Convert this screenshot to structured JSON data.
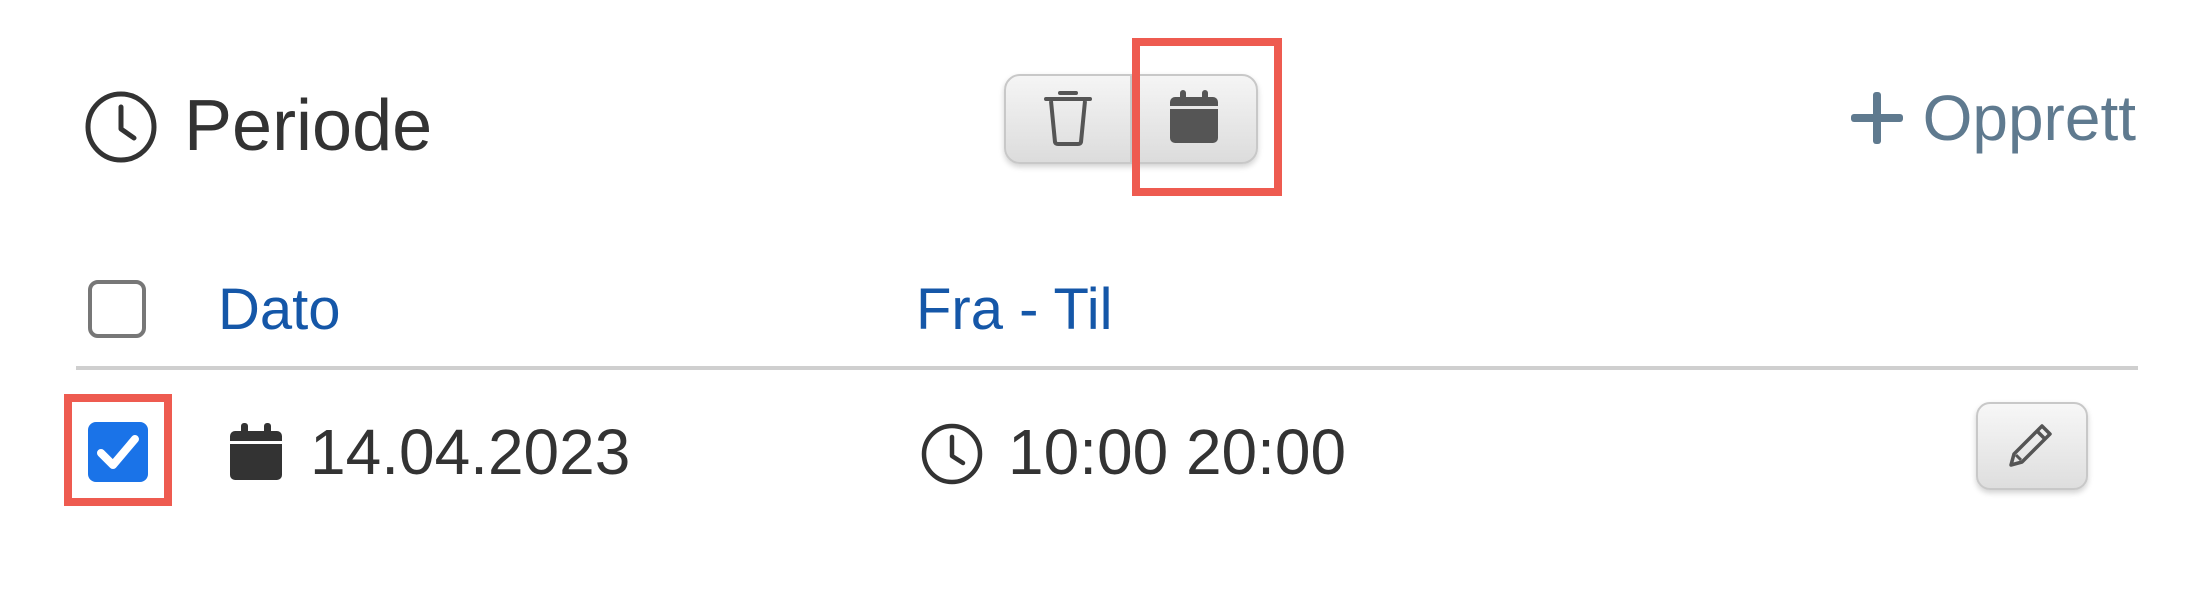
{
  "header": {
    "title": "Periode",
    "title_icon": "clock-icon",
    "toolbar": {
      "delete_icon": "trash-icon",
      "calendar_icon": "calendar-icon"
    },
    "create_label": "Opprett",
    "create_icon": "plus-icon"
  },
  "table": {
    "columns": [
      "Dato",
      "Fra - Til"
    ],
    "rows": [
      {
        "checked": true,
        "date": "14.04.2023",
        "time": "10:00 20:00",
        "date_icon": "calendar-icon",
        "time_icon": "clock-icon",
        "action_icon": "pencil-icon"
      }
    ]
  },
  "colors": {
    "highlight": "#ee5b50",
    "link": "#1557a8",
    "checkbox_checked": "#1a73e8",
    "create": "#5f7a8f",
    "text": "#333333"
  }
}
